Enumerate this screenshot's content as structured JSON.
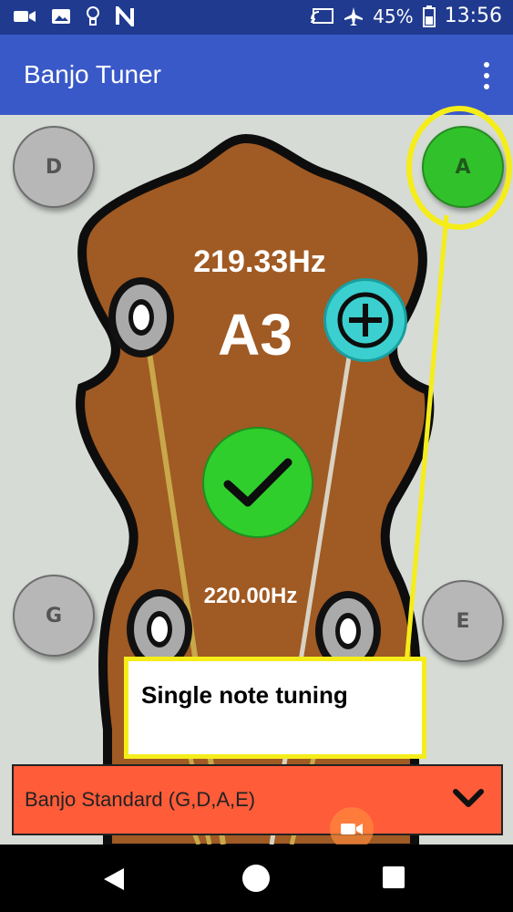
{
  "statusbar": {
    "battery_percent": "45%",
    "time": "13:56",
    "icons": [
      "video-camera-icon",
      "gallery-icon",
      "lightbulb-icon",
      "n-icon",
      "cast-icon",
      "airplane-icon",
      "battery-icon"
    ]
  },
  "appbar": {
    "title": "Banjo Tuner",
    "menu_icon": "more-vert-icon"
  },
  "tuner": {
    "strings": {
      "top_left": "D",
      "top_right": "A",
      "bottom_left": "G",
      "bottom_right": "E"
    },
    "selected_string": "A",
    "detected_frequency": "219.33Hz",
    "detected_note": "A3",
    "target_frequency": "220.00Hz",
    "in_tune_icon": "checkmark-icon",
    "add_icon": "plus-circle-icon"
  },
  "callout": {
    "text": "Single note tuning"
  },
  "tuning_select": {
    "value": "Banjo Standard (G,D,A,E)"
  },
  "colors": {
    "appbar": "#3a59c8",
    "statusbar": "#1f3a8f",
    "headstock": "#a05a23",
    "active_string": "#31c22b",
    "highlight": "#f5ed1a",
    "dropdown": "#ff5c3a"
  }
}
